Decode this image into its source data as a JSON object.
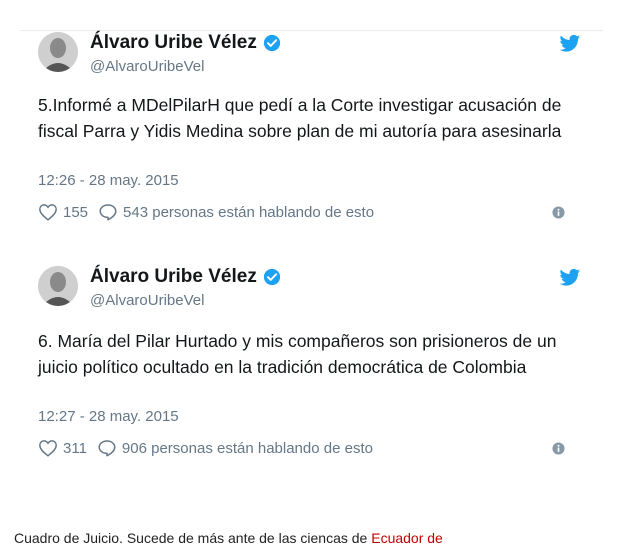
{
  "tweets": [
    {
      "name": "Álvaro Uribe Vélez",
      "handle": "@AlvaroUribeVel",
      "text": "5.Informé a MDelPilarH que pedí a la Corte investigar acusación de fiscal Parra y Yidis Medina sobre plan de mi autoría para asesinarla",
      "time": "12:26 - 28 may. 2015",
      "likes": "155",
      "replies": "543 personas están hablando de esto"
    },
    {
      "name": "Álvaro Uribe Vélez",
      "handle": "@AlvaroUribeVel",
      "text": "6. María del Pilar Hurtado y mis compañeros son prisioneros de un juicio político ocultado en la tradición democrática de Colombia",
      "time": "12:27 - 28 may. 2015",
      "likes": "311",
      "replies": "906 personas están hablando de esto"
    }
  ],
  "caption": {
    "text": "Cuadro de Juicio. Sucede de más ante de las ciencas de",
    "link": "Ecuador de"
  },
  "colors": {
    "twitter_blue": "#1da1f2",
    "secondary_text": "#657786",
    "caption_link": "#c00000"
  },
  "icons": [
    "avatar",
    "verified-badge-icon",
    "twitter-bird-icon",
    "heart-icon",
    "reply-bubble-icon",
    "info-icon"
  ]
}
